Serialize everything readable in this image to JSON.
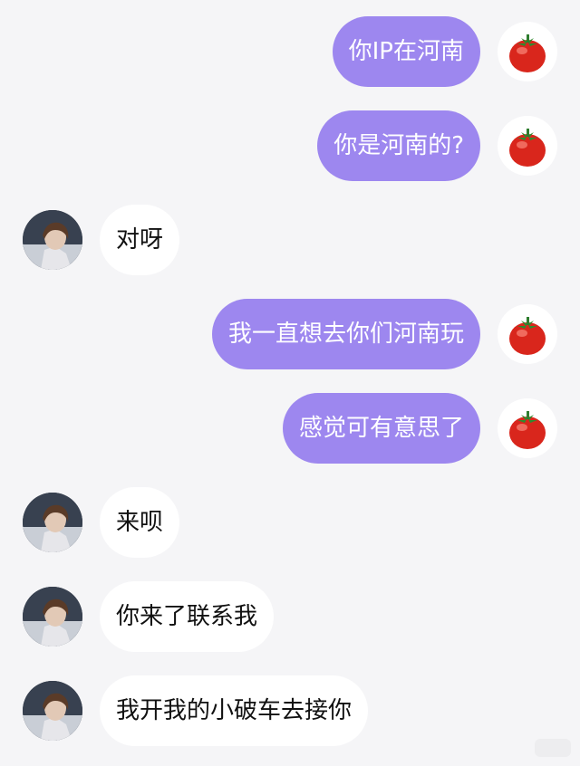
{
  "colors": {
    "background": "#f5f5f7",
    "outgoing_bubble": "#9d87ef",
    "outgoing_text": "#ffffff",
    "incoming_bubble": "#ffffff",
    "incoming_text": "#111111"
  },
  "avatars": {
    "me": "tomato-avatar-icon",
    "them": "person-avatar"
  },
  "messages": [
    {
      "from": "me",
      "text": "你IP在河南"
    },
    {
      "from": "me",
      "text": "你是河南的?"
    },
    {
      "from": "them",
      "text": "对呀"
    },
    {
      "from": "me",
      "text": "我一直想去你们河南玩"
    },
    {
      "from": "me",
      "text": "感觉可有意思了"
    },
    {
      "from": "them",
      "text": "来呗"
    },
    {
      "from": "them",
      "text": "你来了联系我"
    },
    {
      "from": "them",
      "text": "我开我的小破车去接你"
    }
  ]
}
